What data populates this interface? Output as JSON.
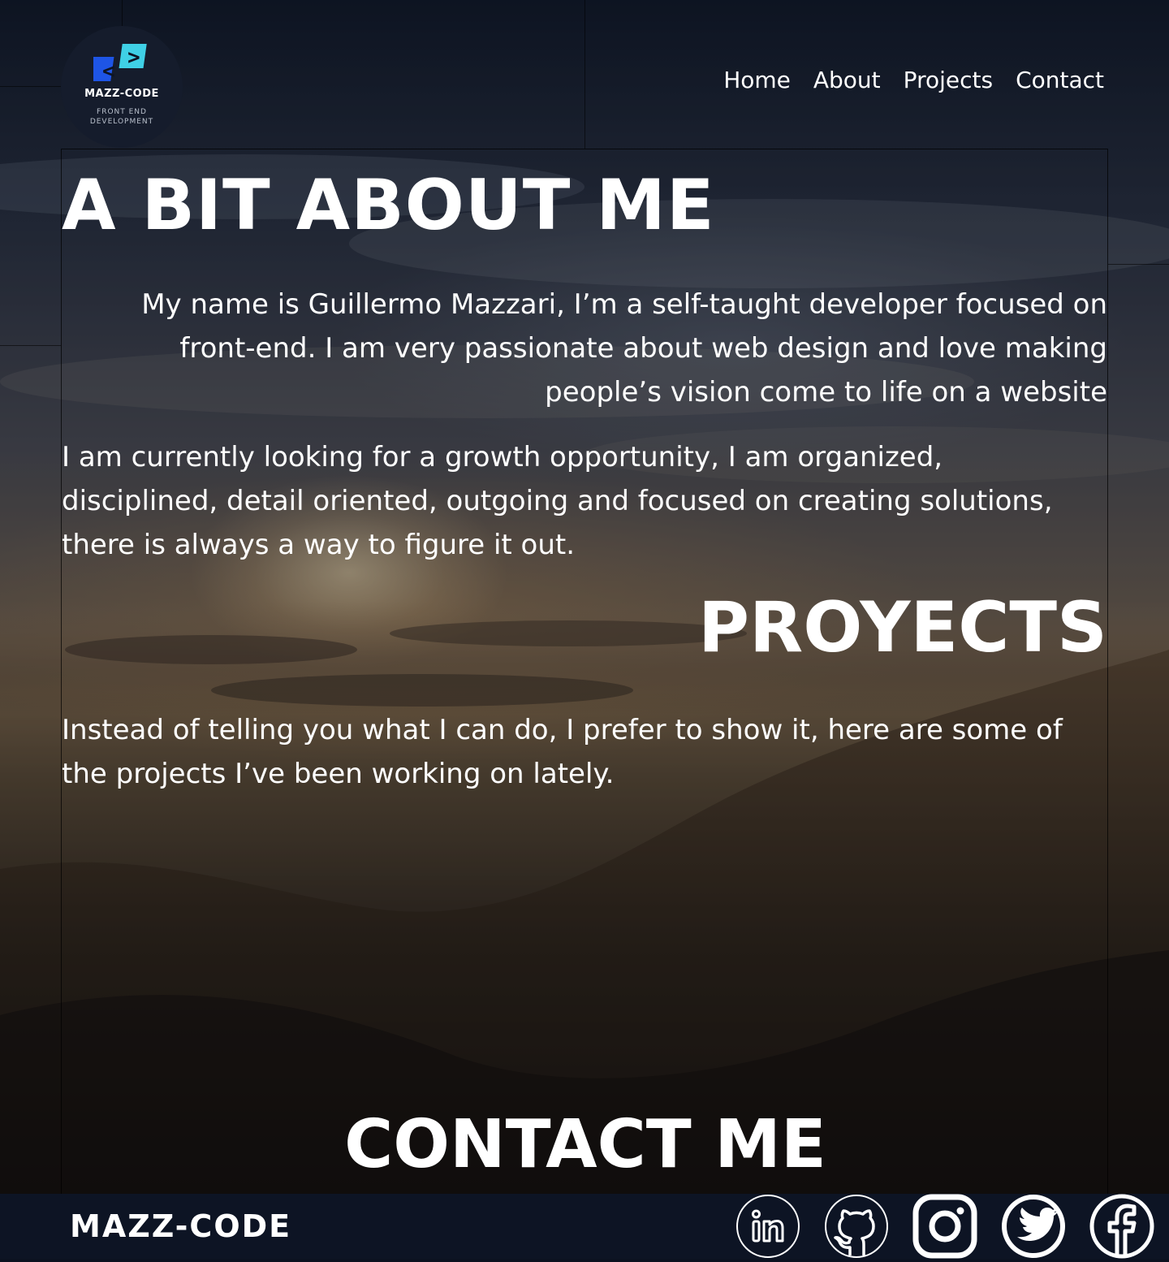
{
  "brand": {
    "logo_open_glyph": "<",
    "logo_close_glyph": ">",
    "logo_name": "MAZZ-CODE",
    "logo_subtitle": "FRONT END\nDEVELOPMENT",
    "colors": {
      "open_glyph_bg": "#1e55e6",
      "close_glyph_bg": "#3fd0e6"
    }
  },
  "nav": {
    "items": [
      {
        "label": "Home"
      },
      {
        "label": "About"
      },
      {
        "label": "Projects"
      },
      {
        "label": "Contact"
      }
    ]
  },
  "about": {
    "title": "A BIT ABOUT ME",
    "paragraph_1": "My name is Guillermo Mazzari, I’m a  self-taught developer focused on front-end. I am very passionate about web design and love making people’s vision come to life on a website",
    "paragraph_2": "I am currently looking for a growth opportunity, I am organized, disciplined, detail oriented, outgoing and focused on creating solutions, there is always a way to figure it out."
  },
  "projects": {
    "title": "PROYECTS",
    "paragraph": "Instead of telling you what I can do, I prefer to show it, here are some of the projects I’ve been working on lately."
  },
  "contact": {
    "title": "CONTACT ME"
  },
  "footer": {
    "brand": "MAZZ-CODE",
    "socials": [
      {
        "icon": "linkedin-icon"
      },
      {
        "icon": "github-icon"
      },
      {
        "icon": "instagram-icon"
      },
      {
        "icon": "twitter-icon"
      },
      {
        "icon": "facebook-icon"
      }
    ]
  }
}
